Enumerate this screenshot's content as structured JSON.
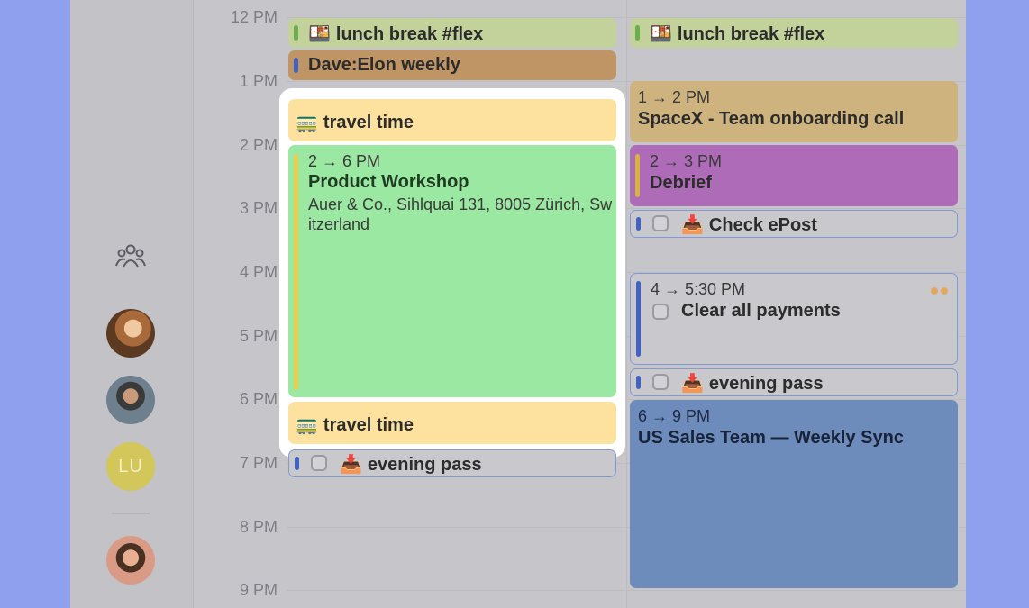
{
  "time_labels": [
    "12 PM",
    "1 PM",
    "2 PM",
    "3 PM",
    "4 PM",
    "5 PM",
    "6 PM",
    "7 PM",
    "8 PM",
    "9 PM"
  ],
  "sidebar": {
    "avatar_initials": "LU"
  },
  "colors": {
    "background": "#8fa0ee",
    "green_event": "#9be8a2",
    "travel_event": "#fde29f",
    "olive_event": "#c3d29a",
    "brown_event": "#c09566",
    "tan_event": "#cfb37f",
    "purple_event": "#ae6bb7",
    "blue_event": "#6e8cbb"
  },
  "day1": {
    "lunch": {
      "icon": "bento-icon",
      "title": "lunch break #flex"
    },
    "dave": {
      "title": "Dave:Elon weekly"
    },
    "travel1": {
      "icon": "tram-icon",
      "title": "travel time"
    },
    "workshop": {
      "time": "2 → 6 PM",
      "title": "Product Workshop",
      "location": "Auer & Co., Sihlquai 131, 8005 Zürich, Switzerland"
    },
    "travel2": {
      "icon": "tram-icon",
      "title": "travel time"
    },
    "evening": {
      "icon": "inbox-icon",
      "title": "evening pass"
    }
  },
  "day2": {
    "lunch": {
      "icon": "bento-icon",
      "title": "lunch break #flex"
    },
    "spacex": {
      "time": "1 → 2 PM",
      "title": "SpaceX - Team onboarding call"
    },
    "debrief": {
      "time": "2 → 3 PM",
      "title": "Debrief"
    },
    "epost": {
      "icon": "inbox-icon",
      "title": "Check ePost"
    },
    "payments": {
      "time": "4 → 5:30 PM",
      "title": "Clear all payments"
    },
    "evening": {
      "icon": "inbox-icon",
      "title": "evening pass"
    },
    "sales": {
      "time": "6 → 9 PM",
      "title": "US Sales Team — Weekly Sync"
    }
  }
}
